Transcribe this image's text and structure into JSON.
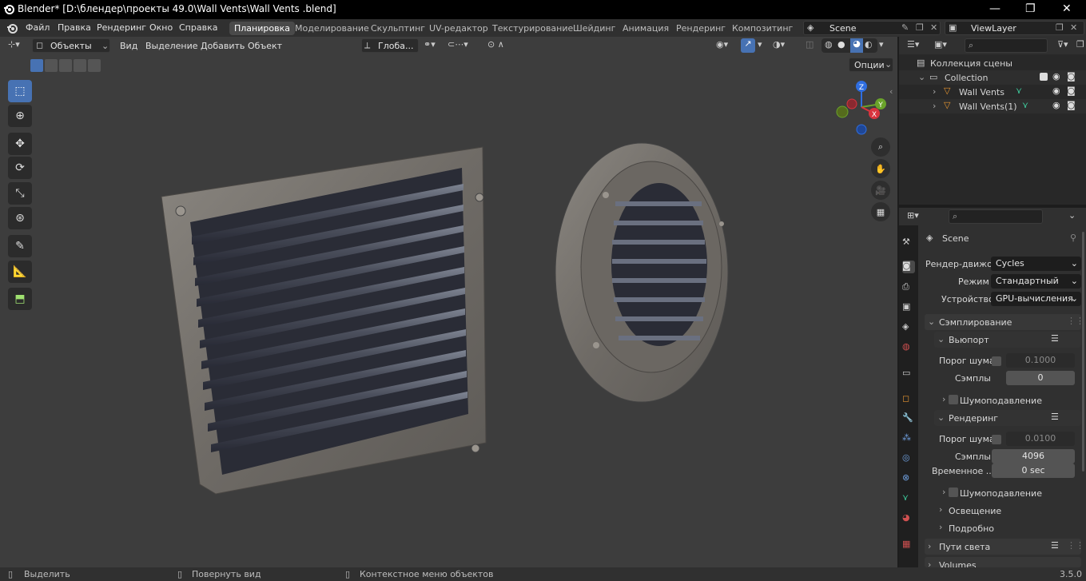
{
  "window": {
    "title": "Blender* [D:\\блендер\\проекты 49.0\\Wall Vents\\Wall Vents .blend]",
    "minimize": "—",
    "maximize": "❐",
    "close": "✕"
  },
  "menu": [
    "Файл",
    "Правка",
    "Рендеринг",
    "Окно",
    "Справка"
  ],
  "workspaces": [
    "Планировка",
    "Моделирование",
    "Скульптинг",
    "UV-редактор",
    "Текстурирование",
    "Шейдинг",
    "Анимация",
    "Рендеринг",
    "Композитинг"
  ],
  "scene": {
    "name": "Scene",
    "view_layer": "ViewLayer"
  },
  "viewport": {
    "mode": "Объекты",
    "menu": [
      "Вид",
      "Выделение",
      "Добавить",
      "Объект"
    ],
    "transform_orientation": "Глоба...",
    "options": "Опции",
    "gizmo": {
      "z": "Z",
      "y": "Y",
      "x": "X"
    }
  },
  "toolbar": [
    "select-box-icon",
    "cursor-icon",
    "move-icon",
    "rotate-icon",
    "scale-icon",
    "transform-icon",
    "annotate-icon",
    "measure-icon",
    "add-cube-icon"
  ],
  "outliner": {
    "root": "Коллекция сцены",
    "collection": "Collection",
    "objects": [
      "Wall Vents",
      "Wall Vents(1)"
    ]
  },
  "properties": {
    "context": "Scene",
    "render_engine": {
      "label": "Рендер-движок",
      "value": "Cycles"
    },
    "feature_set": {
      "label": "Режим",
      "value": "Стандартный"
    },
    "device": {
      "label": "Устройство",
      "value": "GPU-вычисления"
    },
    "sampling": "Сэмплирование",
    "viewport_panel": "Вьюпорт",
    "vp_noise_threshold": {
      "label": "Порог шума",
      "value": "0.1000"
    },
    "vp_samples": {
      "label": "Сэмплы",
      "value": "0"
    },
    "vp_denoise": "Шумоподавление",
    "render_panel": "Рендеринг",
    "r_noise_threshold": {
      "label": "Порог шума",
      "value": "0.0100"
    },
    "r_samples": {
      "label": "Сэмплы",
      "value": "4096"
    },
    "r_time_limit": {
      "label": "Временное ...",
      "value": "0 sec"
    },
    "r_denoise": "Шумоподавление",
    "lights": "Освещение",
    "advanced": "Подробно",
    "light_paths": "Пути света",
    "volumes": "Volumes"
  },
  "status": {
    "select": "Выделить",
    "rotate": "Повернуть вид",
    "context": "Контекстное меню объектов",
    "version": "3.5.0"
  }
}
